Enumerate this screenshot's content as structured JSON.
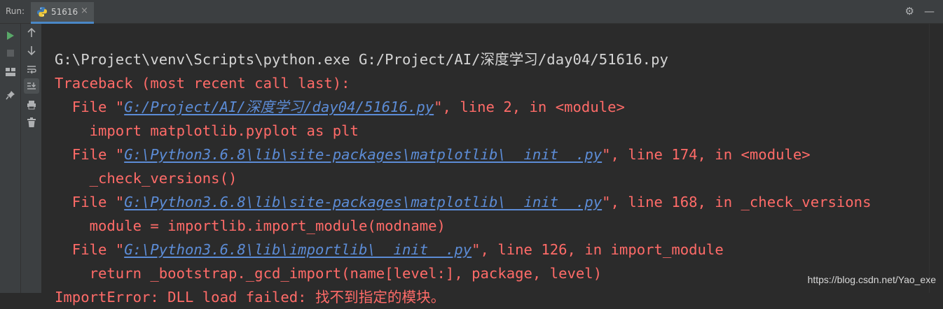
{
  "titlebar": {
    "run_label": "Run:",
    "tab_label": "51616",
    "tab_close": "×"
  },
  "console": {
    "command": "G:\\Project\\venv\\Scripts\\python.exe G:/Project/AI/深度学习/day04/51616.py",
    "traceback_header": "Traceback (most recent call last):",
    "frames": [
      {
        "file_prefix": "  File \"",
        "path": "G:/Project/AI/深度学习/day04/51616.py",
        "suffix": "\", line 2, in <module>",
        "code": "    import matplotlib.pyplot as plt"
      },
      {
        "file_prefix": "  File \"",
        "path": "G:\\Python3.6.8\\lib\\site-packages\\matplotlib\\__init__.py",
        "suffix": "\", line 174, in <module>",
        "code": "    _check_versions()"
      },
      {
        "file_prefix": "  File \"",
        "path": "G:\\Python3.6.8\\lib\\site-packages\\matplotlib\\__init__.py",
        "suffix": "\", line 168, in _check_versions",
        "code": "    module = importlib.import_module(modname)"
      },
      {
        "file_prefix": "  File \"",
        "path": "G:\\Python3.6.8\\lib\\importlib\\__init__.py",
        "suffix": "\", line 126, in import_module",
        "code": "    return _bootstrap._gcd_import(name[level:], package, level)"
      }
    ],
    "error_line": "ImportError: DLL load failed: 找不到指定的模块。"
  },
  "watermark": "https://blog.csdn.net/Yao_exe",
  "colors": {
    "background": "#2b2b2b",
    "panel": "#3c3f41",
    "stderr": "#ff6b68",
    "stdout": "#d4d4d4",
    "link": "#5c8cd6",
    "run_green": "#59a869"
  },
  "icons": {
    "rerun": "run-icon",
    "stop": "stop-icon",
    "layout": "layout-icon",
    "pin": "pin-icon",
    "up": "arrow-up-icon",
    "down": "arrow-down-icon",
    "wrap": "soft-wrap-icon",
    "scroll_end": "scroll-to-end-icon",
    "print": "print-icon",
    "trash": "trash-icon",
    "settings": "gear-icon",
    "hide": "minimize-icon"
  }
}
